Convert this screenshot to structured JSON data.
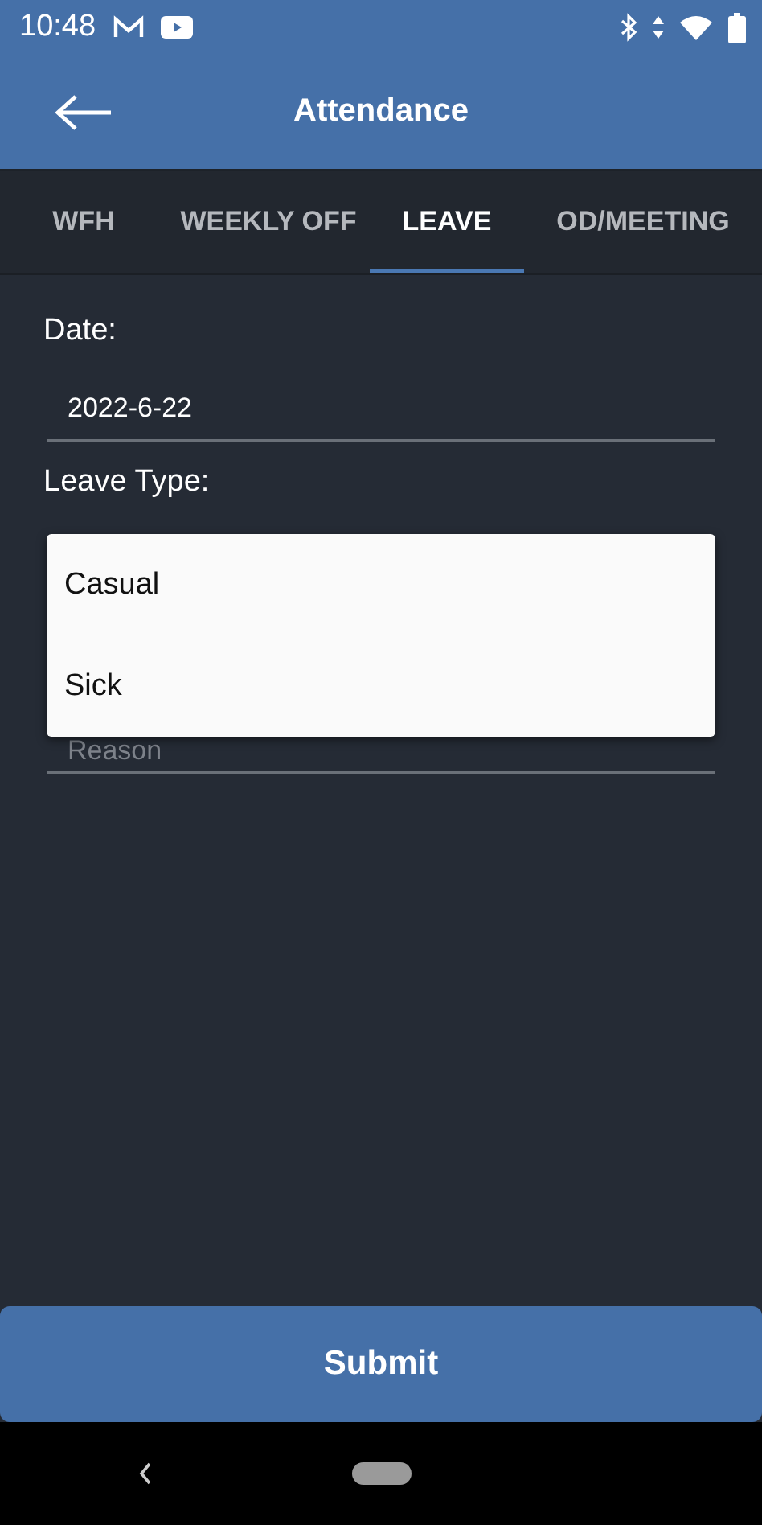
{
  "status_bar": {
    "time": "10:48"
  },
  "app_bar": {
    "title": "Attendance"
  },
  "tabs": [
    {
      "label": "WFH",
      "selected": false
    },
    {
      "label": "WEEKLY OFF",
      "selected": false
    },
    {
      "label": "LEAVE",
      "selected": true
    },
    {
      "label": "OD/MEETING",
      "selected": false
    }
  ],
  "form": {
    "date_label": "Date:",
    "date_value": "2022-6-22",
    "leave_type_label": "Leave Type:",
    "reason_placeholder": "Reason"
  },
  "leave_type_menu": {
    "options": [
      {
        "label": "Casual"
      },
      {
        "label": "Sick"
      }
    ]
  },
  "submit_button": "Submit"
}
